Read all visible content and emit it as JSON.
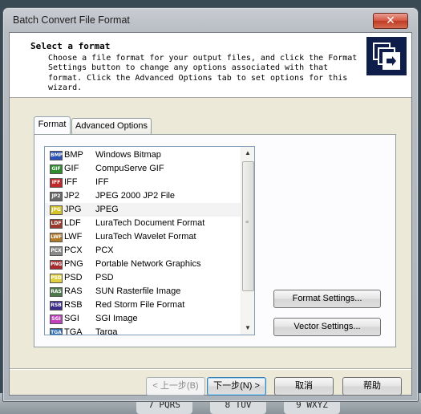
{
  "window": {
    "title": "Batch Convert File Format",
    "close": "✕"
  },
  "header": {
    "title": "Select a format",
    "description": "Choose a file format for your output files, and click the Format\nSettings button to change any options associated with that\nformat. Click the Advanced Options tab to set options for this\nwizard."
  },
  "tabs": [
    {
      "label": "Format",
      "active": true
    },
    {
      "label": "Advanced Options",
      "active": false
    }
  ],
  "formats": [
    {
      "ext": "BMP",
      "desc": "Windows Bitmap",
      "icon_color": "#2a4fb8"
    },
    {
      "ext": "GIF",
      "desc": "CompuServe GIF",
      "icon_color": "#2e8b2e"
    },
    {
      "ext": "IFF",
      "desc": "IFF",
      "icon_color": "#c0282c"
    },
    {
      "ext": "JP2",
      "desc": "JPEG 2000 JP2 File",
      "icon_color": "#6a6a6a"
    },
    {
      "ext": "JPG",
      "desc": "JPEG",
      "icon_color": "#d4c42a"
    },
    {
      "ext": "LDF",
      "desc": "LuraTech Document Format",
      "icon_color": "#9a3a2a"
    },
    {
      "ext": "LWF",
      "desc": "LuraTech Wavelet Format",
      "icon_color": "#b07a2a"
    },
    {
      "ext": "PCX",
      "desc": "PCX",
      "icon_color": "#8a8a8a"
    },
    {
      "ext": "PNG",
      "desc": "Portable Network Graphics",
      "icon_color": "#a82a2a"
    },
    {
      "ext": "PSD",
      "desc": "PSD",
      "icon_color": "#e0d040"
    },
    {
      "ext": "RAS",
      "desc": "SUN Rasterfile Image",
      "icon_color": "#4a7a4a"
    },
    {
      "ext": "RSB",
      "desc": "Red Storm File Format",
      "icon_color": "#3a2a8a"
    },
    {
      "ext": "SGI",
      "desc": "SGI Image",
      "icon_color": "#c040c0"
    },
    {
      "ext": "TGA",
      "desc": "Targa",
      "icon_color": "#2a6ab0"
    }
  ],
  "selected_format": "JPG",
  "buttons": {
    "format_settings": "Format Settings...",
    "vector_settings": "Vector Settings...",
    "back": "< 上一步(B)",
    "next": "下一步(N) >",
    "cancel": "取消",
    "help": "帮助"
  },
  "background_keys": [
    "7 PQRS",
    "8 TUV",
    "9 WXYZ"
  ]
}
